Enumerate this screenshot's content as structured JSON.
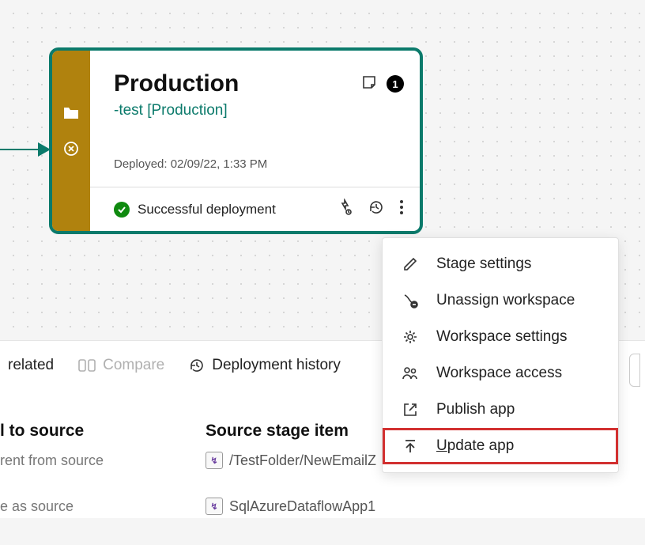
{
  "stage": {
    "title": "Production",
    "subtitle": "-test [Production]",
    "deployed_label": "Deployed: 02/09/22, 1:33 PM",
    "badge_count": "1",
    "status_text": "Successful deployment"
  },
  "menu": {
    "items": [
      {
        "label": "Stage settings"
      },
      {
        "label": "Unassign workspace"
      },
      {
        "label": "Workspace settings"
      },
      {
        "label": "Workspace access"
      },
      {
        "label": "Publish app"
      },
      {
        "label": "Update app"
      }
    ]
  },
  "toolbar": {
    "related": "related",
    "compare": "Compare",
    "history": "Deployment history"
  },
  "columns": {
    "left": "l to source",
    "right": "Source stage item"
  },
  "rows": [
    {
      "left": "rent from source",
      "right": "/TestFolder/NewEmailZ"
    },
    {
      "left": "e as source",
      "right": "SqlAzureDataflowApp1"
    }
  ]
}
